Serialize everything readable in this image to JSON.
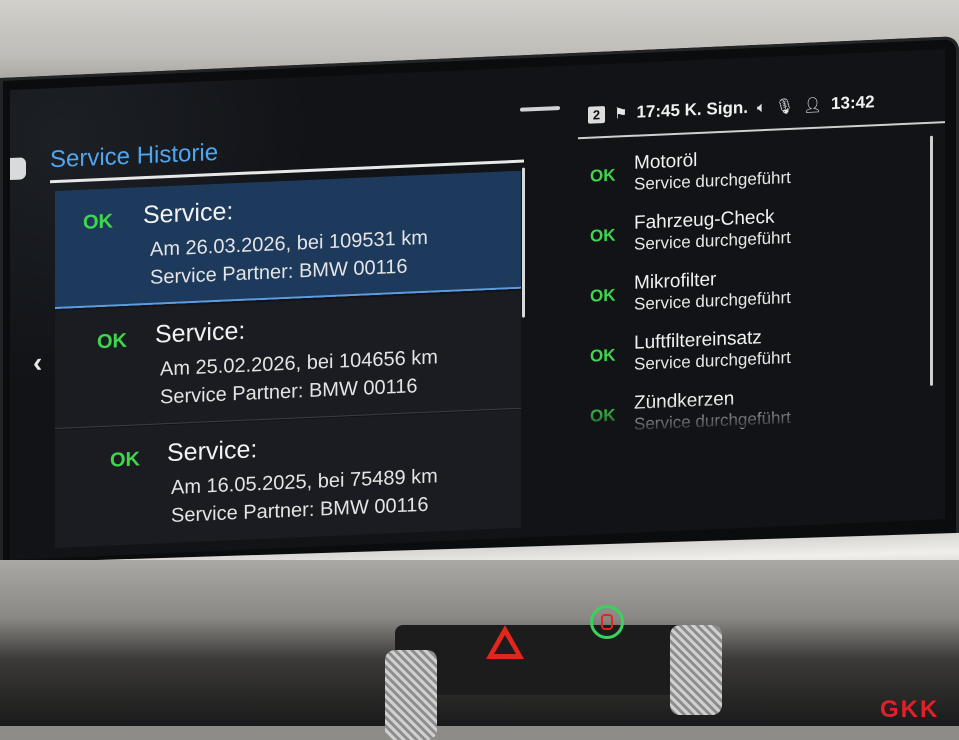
{
  "header": {
    "title": "Service Historie"
  },
  "status_bar": {
    "badge": "2",
    "nav_time": "17:45 K. Sign.",
    "clock": "13:42"
  },
  "service_history": [
    {
      "status": "OK",
      "title": "Service:",
      "date_line": "Am 26.03.2026, bei 109531 km",
      "partner_line": "Service Partner: BMW 00116"
    },
    {
      "status": "OK",
      "title": "Service:",
      "date_line": "Am 25.02.2026, bei 104656 km",
      "partner_line": "Service Partner: BMW 00116"
    },
    {
      "status": "OK",
      "title": "Service:",
      "date_line": "Am 16.05.2025, bei 75489 km",
      "partner_line": "Service Partner: BMW 00116"
    }
  ],
  "service_items": [
    {
      "status": "OK",
      "name": "Motoröl",
      "state": "Service durchgeführt"
    },
    {
      "status": "OK",
      "name": "Fahrzeug-Check",
      "state": "Service durchgeführt"
    },
    {
      "status": "OK",
      "name": "Mikrofilter",
      "state": "Service durchgeführt"
    },
    {
      "status": "OK",
      "name": "Luftfiltereinsatz",
      "state": "Service durchgeführt"
    },
    {
      "status": "OK",
      "name": "Zündkerzen",
      "state": "Service durchgeführt"
    }
  ],
  "icons": {
    "back": "chevron-left-icon",
    "flag": "checkered-flag-icon",
    "volume": "speaker-icon",
    "mic": "microphone-icon",
    "profile": "user-icon",
    "hazard": "hazard-warning-icon",
    "assist": "driving-assistant-icon"
  },
  "colors": {
    "accent": "#4fa6ef",
    "ok": "#3ed64b",
    "selected_row": "#1d3a5c",
    "hazard": "#e3261b",
    "logo": "#e1202a"
  },
  "watermark": {
    "text": "GKK"
  }
}
